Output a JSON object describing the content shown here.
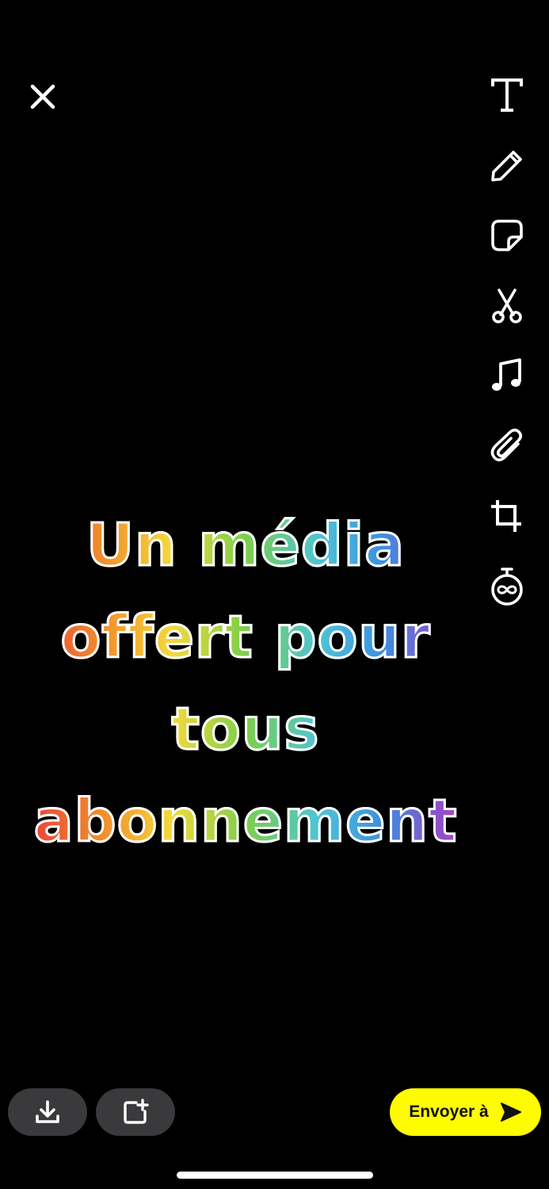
{
  "caption": {
    "lines": [
      "Un média",
      "offert pour",
      "tous",
      "abonnement"
    ]
  },
  "send_button": {
    "label": "Envoyer à"
  },
  "icons": {
    "close": "close-icon",
    "tools": [
      "text-icon",
      "pencil-icon",
      "sticker-icon",
      "scissors-icon",
      "music-icon",
      "paperclip-icon",
      "crop-icon",
      "timer-icon"
    ],
    "download": "download-icon",
    "add_story": "add-story-icon",
    "send": "send-arrow-icon"
  },
  "colors": {
    "background": "#000000",
    "send_button": "#fffc00",
    "secondary_button": "#3a3a3c",
    "icon": "#ffffff"
  }
}
